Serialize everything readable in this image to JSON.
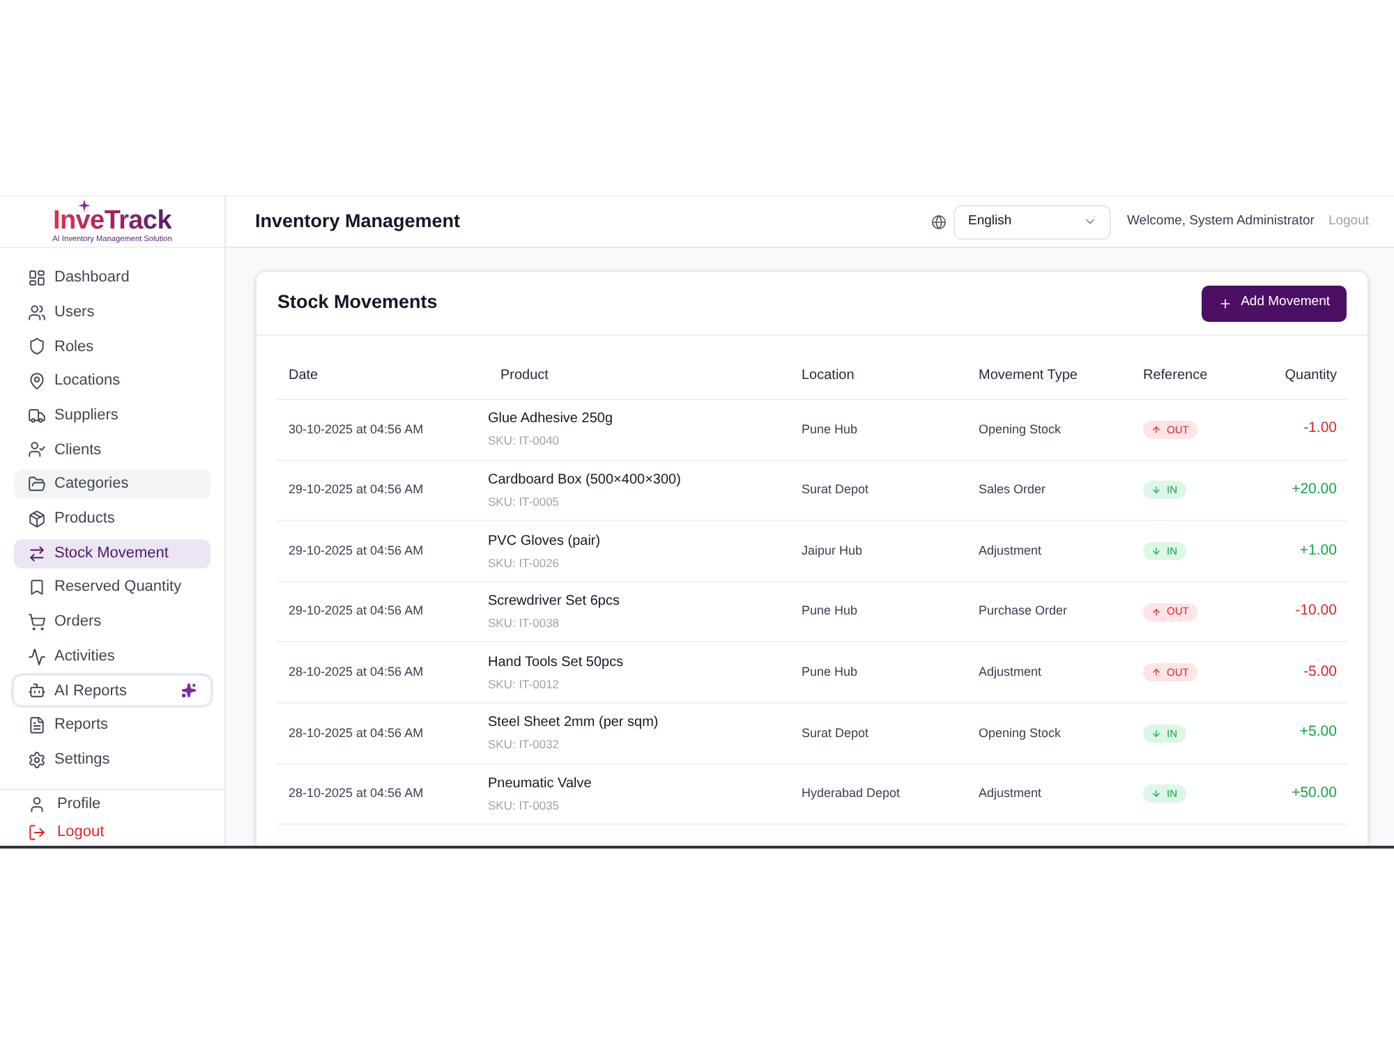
{
  "logo": {
    "name": "InveTrack",
    "tagline": "AI Inventory Management Solution"
  },
  "sidebar": {
    "items": [
      {
        "label": "Dashboard",
        "kind": "link",
        "selected": false,
        "hovered": false
      },
      {
        "label": "Users",
        "kind": "link",
        "selected": false,
        "hovered": false
      },
      {
        "label": "Roles",
        "kind": "link",
        "selected": false,
        "hovered": false
      },
      {
        "label": "Locations",
        "kind": "link",
        "selected": false,
        "hovered": false
      },
      {
        "label": "Suppliers",
        "kind": "link",
        "selected": false,
        "hovered": false
      },
      {
        "label": "Clients",
        "kind": "link",
        "selected": false,
        "hovered": false
      },
      {
        "label": "Categories",
        "kind": "link",
        "selected": false,
        "hovered": true
      },
      {
        "label": "Products",
        "kind": "link",
        "selected": false,
        "hovered": false
      },
      {
        "label": "Stock Movement",
        "kind": "link",
        "selected": true,
        "hovered": false
      },
      {
        "label": "Reserved Quantity",
        "kind": "link",
        "selected": false,
        "hovered": false
      },
      {
        "label": "Orders",
        "kind": "link",
        "selected": false,
        "hovered": false
      },
      {
        "label": "Activities",
        "kind": "link",
        "selected": false,
        "hovered": false
      },
      {
        "label": "AI Reports",
        "kind": "ai",
        "selected": false,
        "hovered": false
      },
      {
        "label": "Reports",
        "kind": "link",
        "selected": false,
        "hovered": false
      },
      {
        "label": "Settings",
        "kind": "link",
        "selected": false,
        "hovered": false
      }
    ],
    "footer": [
      {
        "label": "Profile",
        "kind": "profile"
      },
      {
        "label": "Logout",
        "kind": "logout"
      }
    ]
  },
  "header": {
    "title": "Inventory Management",
    "language": {
      "value": "English"
    },
    "welcome": "Welcome, System Administrator",
    "logout": "Logout"
  },
  "card": {
    "title": "Stock Movements",
    "add_button": "Add Movement"
  },
  "table": {
    "columns": [
      "Date",
      "Product",
      "Location",
      "Movement Type",
      "Reference",
      "Quantity"
    ],
    "rows": [
      {
        "date": "30-10-2025 at 04:56 AM",
        "product": "Glue Adhesive 250g",
        "sku": "SKU: IT-0040",
        "location": "Pune Hub",
        "movement_type": "Opening Stock",
        "reference": {
          "kind": "out",
          "label": "OUT"
        },
        "quantity": "-1.00"
      },
      {
        "date": "29-10-2025 at 04:56 AM",
        "product": "Cardboard Box (500×400×300)",
        "sku": "SKU: IT-0005",
        "location": "Surat Depot",
        "movement_type": "Sales Order",
        "reference": {
          "kind": "in",
          "label": "IN"
        },
        "quantity": "+20.00"
      },
      {
        "date": "29-10-2025 at 04:56 AM",
        "product": "PVC Gloves (pair)",
        "sku": "SKU: IT-0026",
        "location": "Jaipur Hub",
        "movement_type": "Adjustment",
        "reference": {
          "kind": "in",
          "label": "IN"
        },
        "quantity": "+1.00"
      },
      {
        "date": "29-10-2025 at 04:56 AM",
        "product": "Screwdriver Set 6pcs",
        "sku": "SKU: IT-0038",
        "location": "Pune Hub",
        "movement_type": "Purchase Order",
        "reference": {
          "kind": "out",
          "label": "OUT"
        },
        "quantity": "-10.00"
      },
      {
        "date": "28-10-2025 at 04:56 AM",
        "product": "Hand Tools Set 50pcs",
        "sku": "SKU: IT-0012",
        "location": "Pune Hub",
        "movement_type": "Adjustment",
        "reference": {
          "kind": "out",
          "label": "OUT"
        },
        "quantity": "-5.00"
      },
      {
        "date": "28-10-2025 at 04:56 AM",
        "product": "Steel Sheet 2mm (per sqm)",
        "sku": "SKU: IT-0032",
        "location": "Surat Depot",
        "movement_type": "Opening Stock",
        "reference": {
          "kind": "in",
          "label": "IN"
        },
        "quantity": "+5.00"
      },
      {
        "date": "28-10-2025 at 04:56 AM",
        "product": "Pneumatic Valve",
        "sku": "SKU: IT-0035",
        "location": "Hyderabad Depot",
        "movement_type": "Adjustment",
        "reference": {
          "kind": "in",
          "label": "IN"
        },
        "quantity": "+50.00"
      }
    ]
  }
}
